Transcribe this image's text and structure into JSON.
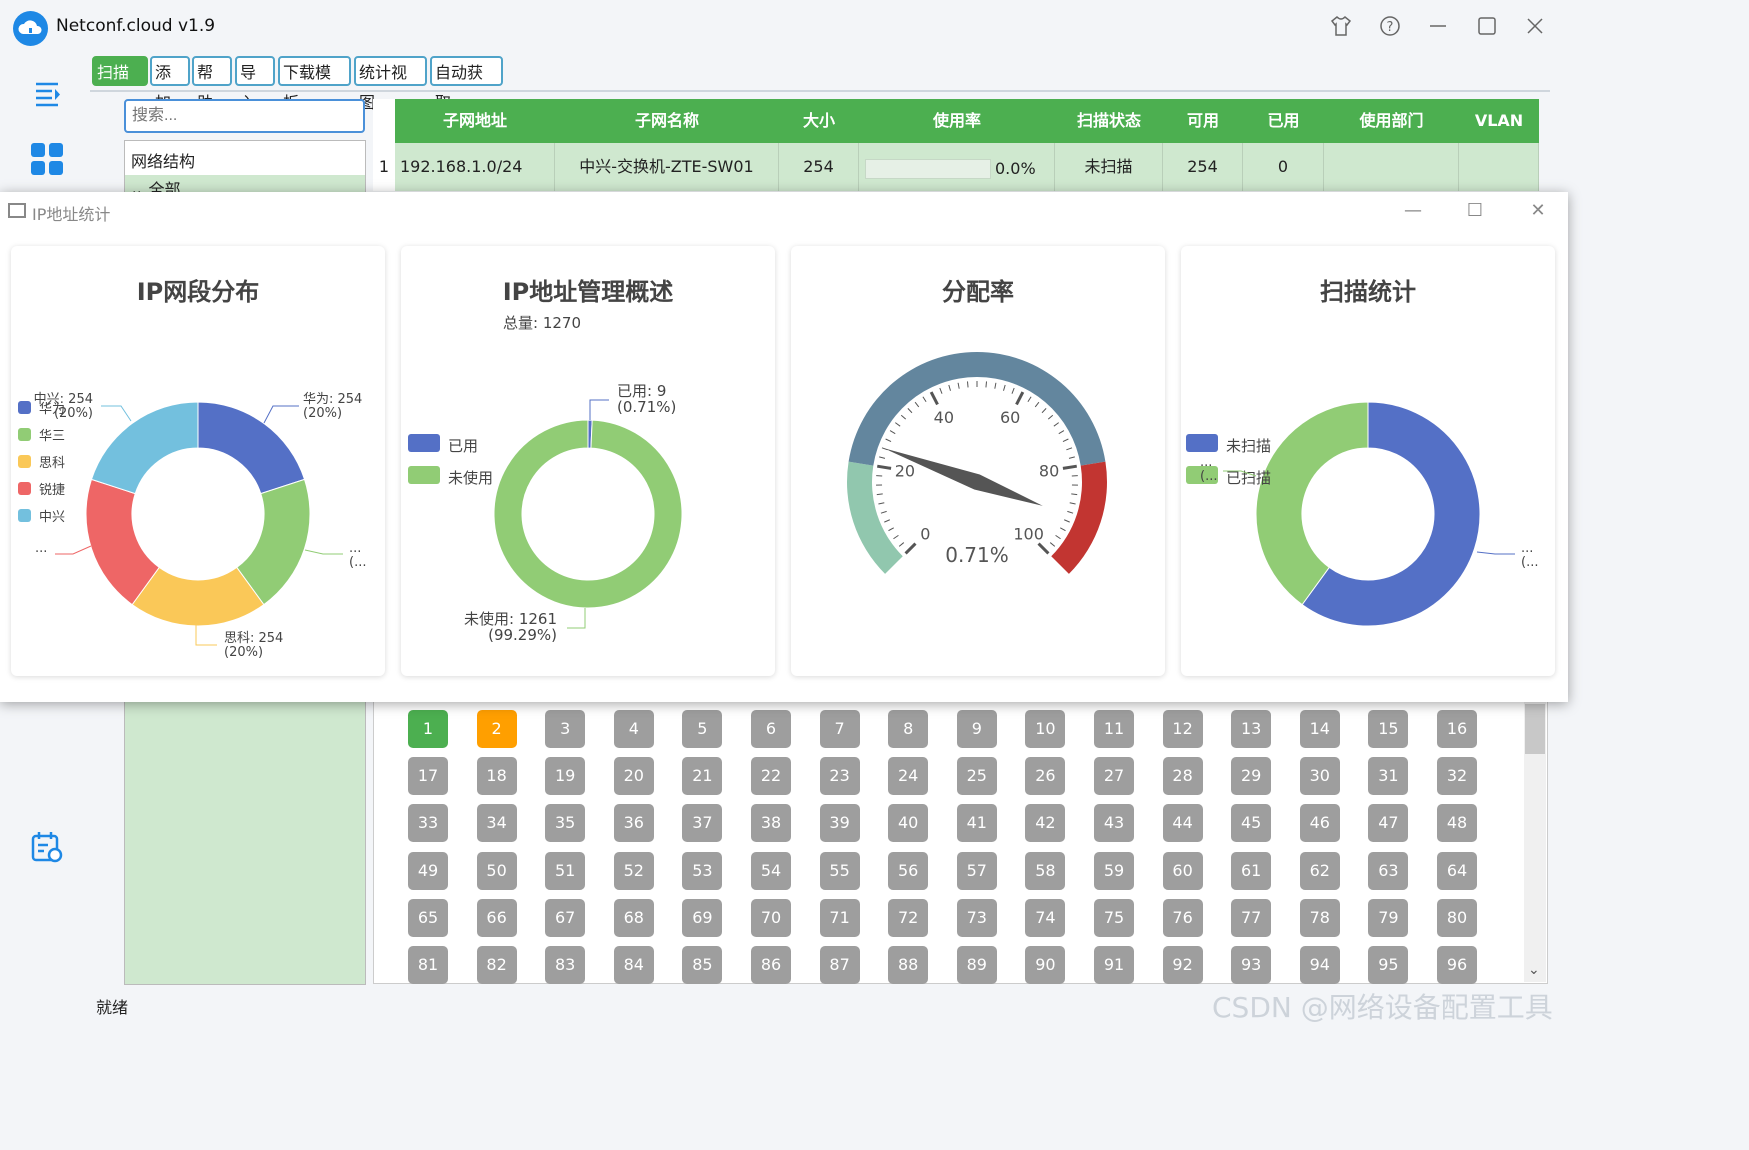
{
  "app": {
    "title": "Netconf.cloud v1.9"
  },
  "toolbar": {
    "buttons": [
      "扫描",
      "添加",
      "帮助",
      "导入",
      "下载模板",
      "统计视图",
      "自动获取"
    ]
  },
  "search": {
    "placeholder": "搜索..."
  },
  "tree": {
    "header": "网络结构",
    "root": "全部"
  },
  "table": {
    "columns": [
      "子网地址",
      "子网名称",
      "大小",
      "使用率",
      "扫描状态",
      "可用",
      "已用",
      "使用部门",
      "VLAN"
    ],
    "rows": [
      {
        "index": "1",
        "subnet": "192.168.1.0/24",
        "name": "中兴-交换机-ZTE-SW01",
        "size": "254",
        "usage": "0.0%",
        "scan": "未扫描",
        "available": "254",
        "used": "0",
        "dept": "",
        "vlan": ""
      }
    ]
  },
  "stats_window": {
    "title": "IP地址统计"
  },
  "charts": {
    "c1": {
      "title": "IP网段分布"
    },
    "c2": {
      "title": "IP地址管理概述",
      "subtitle": "总量: 1270"
    },
    "c3": {
      "title": "分配率"
    },
    "c4": {
      "title": "扫描统计"
    }
  },
  "chart_data": [
    {
      "type": "pie",
      "title": "IP网段分布",
      "donut": true,
      "categories": [
        "华为",
        "华三",
        "思科",
        "锐捷",
        "中兴"
      ],
      "values": [
        254,
        254,
        254,
        254,
        254
      ],
      "colors": [
        "#5470c6",
        "#91cc75",
        "#fac858",
        "#ee6666",
        "#73c0de"
      ],
      "legend": "left",
      "labels": [
        "华为: 254\n(20%)",
        "思科: 254\n(20%)",
        "中兴: 254\n(20%)"
      ],
      "truncated_labels": [
        "...",
        "(...",
        "..."
      ]
    },
    {
      "type": "pie",
      "title": "IP地址管理概述",
      "subtitle": "总量: 1270",
      "donut": true,
      "categories": [
        "已用",
        "未使用"
      ],
      "values": [
        9,
        1261
      ],
      "colors": [
        "#5470c6",
        "#91cc75"
      ],
      "legend": "left",
      "labels": [
        "已用: 9",
        "(0.71%)",
        "未使用: 1261",
        "(99.29%)"
      ]
    },
    {
      "type": "gauge",
      "title": "分配率",
      "value": 0.71,
      "value_label": "0.71%",
      "min": 0,
      "max": 100,
      "ticks": [
        "0",
        "20",
        "40",
        "60",
        "80",
        "100"
      ],
      "band_colors": [
        "#91c7ae",
        "#63869e",
        "#c23531"
      ]
    },
    {
      "type": "pie",
      "title": "扫描统计",
      "donut": true,
      "categories": [
        "未扫描",
        "已扫描"
      ],
      "values": [
        60,
        40
      ],
      "colors": [
        "#5470c6",
        "#91cc75"
      ],
      "legend": "left",
      "truncated_labels": [
        "...",
        "(...",
        "...",
        "(..."
      ]
    }
  ],
  "ip_grid": {
    "start": 1,
    "end": 96,
    "used": [
      1
    ],
    "pending": [
      2
    ]
  },
  "status": {
    "text": "就绪"
  },
  "watermark": {
    "text": "CSDN @网络设备配置工具"
  }
}
